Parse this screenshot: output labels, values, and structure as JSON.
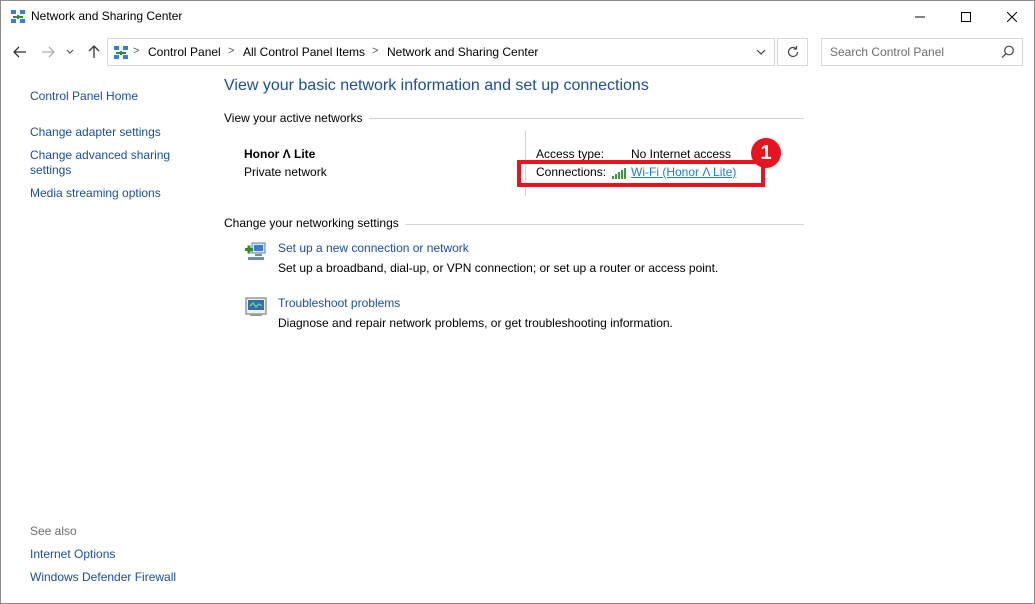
{
  "window": {
    "title": "Network and Sharing Center",
    "icon": "network-sharing-icon"
  },
  "address_bar": {
    "breadcrumbs": [
      "Control Panel",
      "All Control Panel Items",
      "Network and Sharing Center"
    ],
    "separator": ">"
  },
  "search": {
    "placeholder": "Search Control Panel"
  },
  "sidebar": {
    "items": [
      {
        "label": "Control Panel Home"
      },
      {
        "label": "Change adapter settings"
      },
      {
        "label": "Change advanced sharing settings",
        "line1": "Change advanced sharing",
        "line2": "settings"
      },
      {
        "label": "Media streaming options"
      }
    ],
    "see_also_label": "See also",
    "see_also": [
      {
        "label": "Internet Options"
      },
      {
        "label": "Windows Defender Firewall"
      }
    ]
  },
  "main": {
    "title": "View your basic network information and set up connections",
    "active_networks_heading": "View your active networks",
    "network": {
      "name": "Honor Λ Lite",
      "category": "Private network",
      "access_type_label": "Access type:",
      "access_type_value": "No Internet access",
      "connections_label": "Connections:",
      "connections_value": "Wi-Fi (Honor Λ Lite)"
    },
    "settings_heading": "Change your networking settings",
    "tasks": [
      {
        "link": "Set up a new connection or network",
        "description": "Set up a broadband, dial-up, or VPN connection; or set up a router or access point.",
        "icon": "new-connection-icon"
      },
      {
        "link": "Troubleshoot problems",
        "description": "Diagnose and repair network problems, or get troubleshooting information.",
        "icon": "troubleshoot-icon"
      }
    ]
  },
  "annotation": {
    "badge_number": "1",
    "color": "#e8131c"
  },
  "colors": {
    "link": "#1a4e9a",
    "active_link": "#1a7fd6",
    "signal": "#3c9a3c"
  }
}
